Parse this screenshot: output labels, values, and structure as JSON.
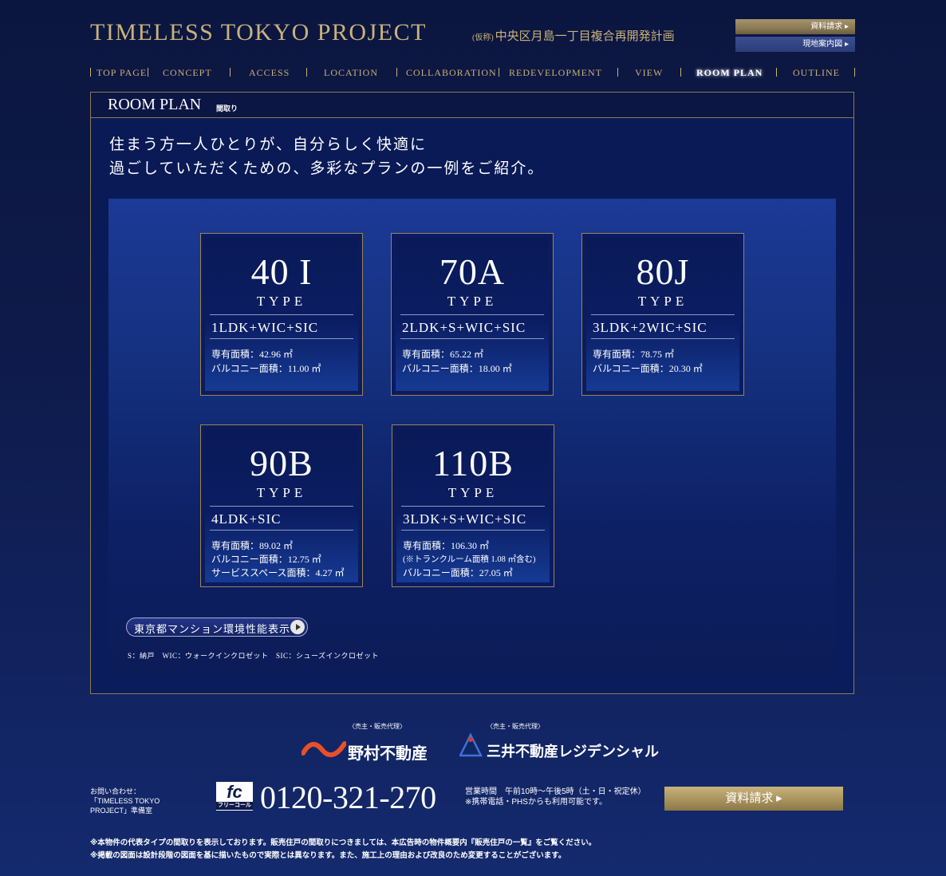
{
  "header": {
    "title": "TIMELESS TOKYO PROJECT",
    "subtitle_prefix": "(仮称)",
    "subtitle": "中央区月島一丁目複合再開発計画",
    "request_docs": "資料請求 ▸",
    "site_map": "現地案内図 ▸"
  },
  "nav": {
    "items": [
      "TOP PAGE",
      "CONCEPT",
      "ACCESS",
      "LOCATION",
      "COLLABORATION",
      "REDEVELOPMENT",
      "VIEW",
      "ROOM PLAN",
      "OUTLINE"
    ],
    "active": "ROOM PLAN"
  },
  "page": {
    "title": "ROOM PLAN",
    "title_ja": "間取り",
    "lead_line1": "住まう方一人ひとりが、自分らしく快適に",
    "lead_line2": "過ごしていただくための、多彩なプランの一例をご紹介。"
  },
  "plans": [
    {
      "type": "40 I",
      "type_label": "TYPE",
      "layout": "1LDK+WIC+SIC",
      "specs": [
        "専有面積：42.96 ㎡",
        "バルコニー面積：11.00 ㎡"
      ]
    },
    {
      "type": "70A",
      "type_label": "TYPE",
      "layout": "2LDK+S+WIC+SIC",
      "specs": [
        "専有面積：65.22 ㎡",
        "バルコニー面積：18.00 ㎡"
      ]
    },
    {
      "type": "80J",
      "type_label": "TYPE",
      "layout": "3LDK+2WIC+SIC",
      "specs": [
        "専有面積：78.75 ㎡",
        "バルコニー面積：20.30 ㎡"
      ]
    },
    {
      "type": "90B",
      "type_label": "TYPE",
      "layout": "4LDK+SIC",
      "specs": [
        "専有面積：89.02 ㎡",
        "バルコニー面積：12.75 ㎡",
        "サービススペース面積：4.27 ㎡"
      ]
    },
    {
      "type": "110B",
      "type_label": "TYPE",
      "layout": "3LDK+S+WIC+SIC",
      "specs": [
        "専有面積：106.30 ㎡",
        "(※トランクルーム面積 1.08 ㎡含む)",
        "バルコニー面積：27.05 ㎡"
      ]
    }
  ],
  "env_button": "東京都マンション環境性能表示",
  "legend": "S：納戸　WIC：ウォークインクロゼット　SIC：シューズインクロゼット",
  "logos": {
    "nomura_caption": "〈売主・販売代理〉",
    "nomura": "野村不動産",
    "mitsui_caption": "〈売主・販売代理〉",
    "mitsui": "三井不動産レジデンシャル"
  },
  "footer": {
    "contact": "お問い合わせ：「TIMELESS TOKYO PROJECT」準備室",
    "freecall_mark": "fc",
    "freecall_label": "フリーコール",
    "phone": "0120-321-270",
    "hours": "営業時間　午前10時〜午後5時（土・日・祝定休）",
    "mobile_note": "※携帯電話・PHSからも利用可能です。",
    "request_button": "資料請求 ▸",
    "note1": "※本物件の代表タイプの間取りを表示しております。販売住戸の間取りにつきましては、本広告時の物件概要内『販売住戸の一覧』をご覧ください。",
    "note2": "※掲載の図面は設計段階の図面を基に描いたもので実際とは異なります。また、施工上の理由および改良のため変更することがございます。"
  },
  "colors": {
    "gold": "#c9b27a",
    "navy": "#0e1a4a",
    "panel": "#0a1c5c"
  }
}
